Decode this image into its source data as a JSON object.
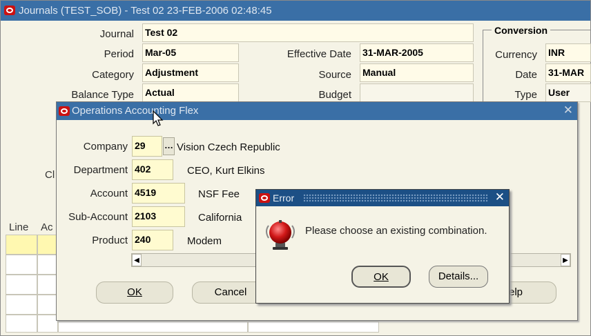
{
  "main_window": {
    "title": "Journals (TEST_SOB) - Test 02 23-FEB-2006 02:48:45",
    "labels": {
      "journal": "Journal",
      "period": "Period",
      "category": "Category",
      "balance_type": "Balance Type",
      "effective_date": "Effective Date",
      "source": "Source",
      "budget": "Budget"
    },
    "values": {
      "journal": "Test 02",
      "period": "Mar-05",
      "category": "Adjustment",
      "balance_type": "Actual",
      "effective_date": "31-MAR-2005",
      "source": "Manual",
      "budget": ""
    },
    "conversion": {
      "title": "Conversion",
      "currency_label": "Currency",
      "currency_value": "INR",
      "date_label": "Date",
      "date_value": "31-MAR",
      "type_label": "Type",
      "type_value": "User"
    },
    "partial_labels": {
      "cl": "Cl",
      "line": "Line",
      "ac": "Ac"
    }
  },
  "flex_dialog": {
    "title": "Operations Accounting Flex",
    "segments": [
      {
        "label": "Company",
        "value": "29",
        "description": "Vision Czech Republic"
      },
      {
        "label": "Department",
        "value": "402",
        "description": "CEO, Kurt Elkins"
      },
      {
        "label": "Account",
        "value": "4519",
        "description": "NSF Fee"
      },
      {
        "label": "Sub-Account",
        "value": "2103",
        "description": "California"
      },
      {
        "label": "Product",
        "value": "240",
        "description": "Modem"
      }
    ],
    "lov_button": "…",
    "ok_label": "OK",
    "cancel_label": "Cancel",
    "help_label": "elp",
    "close_glyph": "✕"
  },
  "error_dialog": {
    "title": "Error",
    "message": "Please choose an existing combination.",
    "ok_label": "OK",
    "details_label": "Details...",
    "close_glyph": "✕"
  },
  "icons": {
    "error_icon": "error-alarm-icon",
    "logo": "oracle-logo-icon"
  },
  "colors": {
    "title_bar": "#3a6fa6",
    "error_title_bar": "#1c4f85",
    "field_bg": "#fffbd0",
    "window_bg": "#f5f3e6"
  }
}
